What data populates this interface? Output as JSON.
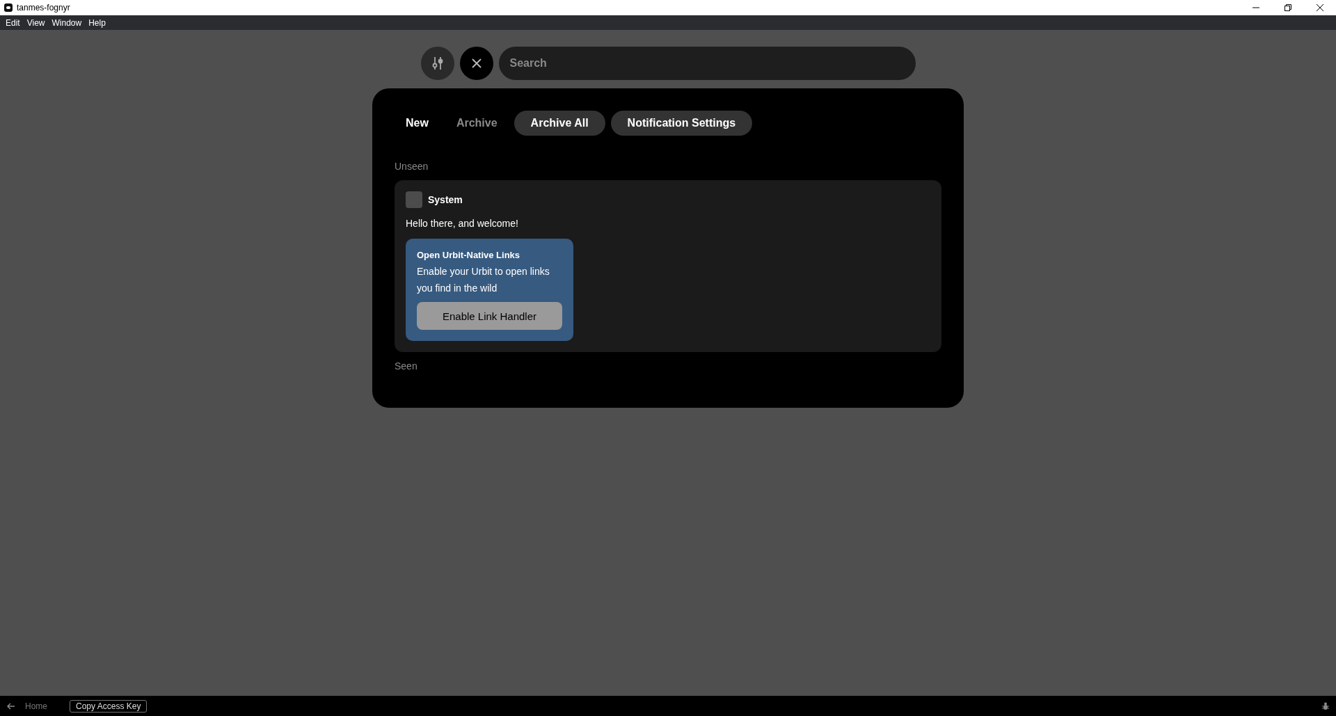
{
  "window": {
    "title": "tanmes-fognyr"
  },
  "menu": [
    "Edit",
    "View",
    "Window",
    "Help"
  ],
  "search": {
    "placeholder": "Search"
  },
  "tabs": [
    {
      "label": "New",
      "selected": true
    },
    {
      "label": "Archive",
      "selected": false
    }
  ],
  "actions": [
    "Archive All",
    "Notification Settings"
  ],
  "sections": [
    {
      "title": "Unseen",
      "notifications": [
        {
          "app": "System",
          "message": "Hello there, and welcome!",
          "prompt": {
            "title": "Open Urbit-Native Links",
            "body": "Enable your Urbit to open links you find in the wild",
            "button": "Enable Link Handler"
          }
        }
      ]
    },
    {
      "title": "Seen"
    }
  ],
  "status_bar": {
    "back_label": "Home",
    "button": "Copy Access Key"
  }
}
